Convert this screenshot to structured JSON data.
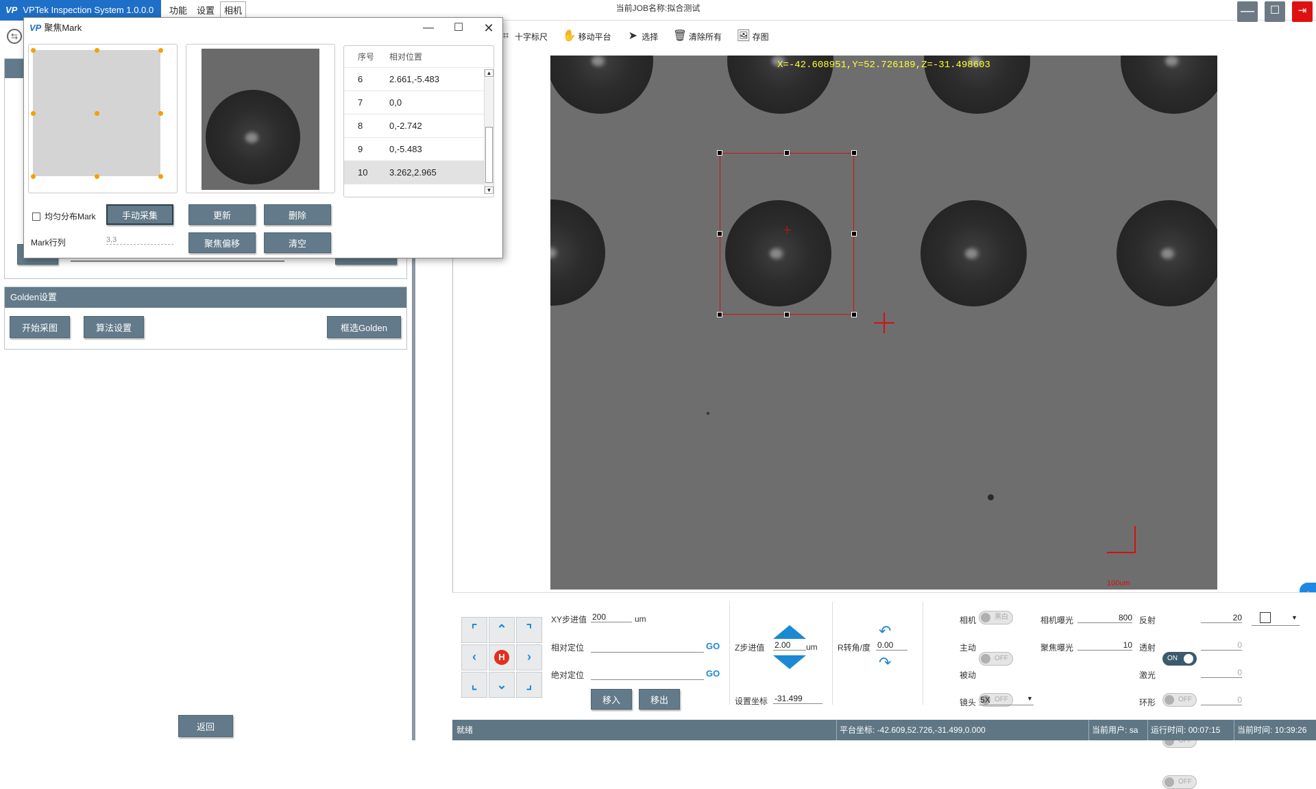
{
  "app": {
    "logo_mark": "VP",
    "title": "VPTek Inspection System 1.0.0.0"
  },
  "menu": [
    "功能",
    "设置",
    "相机"
  ],
  "job": {
    "label": "当前JOB名称:",
    "name": "拟合测试"
  },
  "toolbar": [
    {
      "icon": "crosshair-ruler-icon",
      "label": "十字标尺"
    },
    {
      "icon": "hand-move-icon",
      "label": "移动平台"
    },
    {
      "icon": "cursor-icon",
      "label": "选择"
    },
    {
      "icon": "trash-icon",
      "label": "清除所有"
    },
    {
      "icon": "image-save-icon",
      "label": "存图"
    }
  ],
  "golden": {
    "title": "Golden设置",
    "start": "开始采图",
    "algo": "算法设置",
    "select": "框选Golden"
  },
  "back_label": "返回",
  "camera": {
    "coord_text": "X=-42.608951,Y=52.726189,Z=-31.498603",
    "scale_label": "100um"
  },
  "dialog": {
    "title": "聚焦Mark",
    "table_headers": [
      "序号",
      "相对位置"
    ],
    "rows": [
      {
        "idx": "6",
        "pos": "2.661,-5.483"
      },
      {
        "idx": "7",
        "pos": "0,0"
      },
      {
        "idx": "8",
        "pos": "0,-2.742"
      },
      {
        "idx": "9",
        "pos": "0,-5.483"
      },
      {
        "idx": "10",
        "pos": "3.262,2.965"
      }
    ],
    "uniform_label": "均匀分布Mark",
    "manual_btn": "手动采集",
    "update_btn": "更新",
    "delete_btn": "删除",
    "mark_rowcol_label": "Mark行列",
    "mark_rowcol_value": "3,3",
    "focus_offset_btn": "聚焦偏移",
    "clear_btn": "清空"
  },
  "controls": {
    "xy_step_label": "XY步进值",
    "xy_step_value": "200",
    "xy_unit": "um",
    "rel_pos_label": "相对定位",
    "abs_pos_label": "绝对定位",
    "go": "GO",
    "move_in": "移入",
    "move_out": "移出",
    "z_step_label": "Z步进值",
    "z_step_value": "2.00",
    "z_unit": "um",
    "set_coord_label": "设置坐标",
    "set_coord_value": "-31.499",
    "r_angle_label": "R转角/度",
    "r_angle_value": "0.00",
    "camera_label": "相机",
    "camera_toggle": "黑白",
    "active_label": "主动",
    "active_toggle": "OFF",
    "passive_label": "被动",
    "passive_toggle": "OFF",
    "lens_label": "镜头",
    "lens_value": "5X",
    "cam_exposure_label": "相机曝光",
    "cam_exposure_value": "800",
    "focus_exposure_label": "聚焦曝光",
    "focus_exposure_value": "10",
    "reflect_label": "反射",
    "reflect_toggle": "ON",
    "reflect_value": "20",
    "transmit_label": "透射",
    "transmit_toggle": "OFF",
    "transmit_value": "0",
    "laser_label": "激光",
    "laser_toggle": "OFF",
    "laser_value": "0",
    "ring_label": "环形",
    "ring_toggle": "OFF",
    "ring_value": "0"
  },
  "status": {
    "state": "就绪",
    "platform_label": "平台坐标:",
    "platform_value": "-42.609,52.726,-31.499,0.000",
    "user_label": "当前用户:",
    "user_value": "sa",
    "runtime_label": "运行时间:",
    "runtime_value": "00:07:15",
    "time_label": "当前时间:",
    "time_value": "10:39:26"
  },
  "colors": {
    "accent": "#1e6fc8",
    "panel": "#627a89",
    "status": "#5f7685",
    "marker": "#d41010",
    "coord": "#ffff33"
  }
}
